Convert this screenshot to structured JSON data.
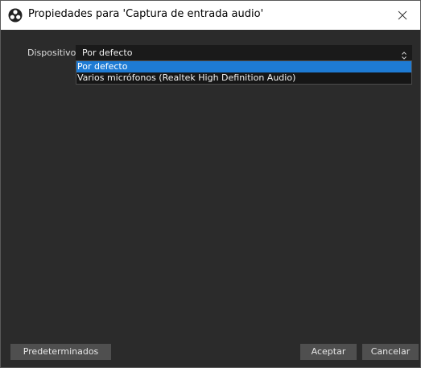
{
  "window": {
    "title": "Propiedades para 'Captura de entrada audio'",
    "icon": "obs-logo-icon",
    "close_icon": "close-icon"
  },
  "form": {
    "device_label": "Dispositivo",
    "device_select": {
      "value": "Por defecto",
      "options": [
        "Por defecto",
        "Varios micrófonos (Realtek High Definition Audio)"
      ],
      "highlighted_index": 0,
      "expanded": true
    }
  },
  "footer": {
    "defaults_label": "Predeterminados",
    "ok_label": "Aceptar",
    "cancel_label": "Cancelar"
  },
  "colors": {
    "background": "#2b2b2b",
    "selection": "#1e7bd4",
    "button": "#4f4f4f"
  }
}
